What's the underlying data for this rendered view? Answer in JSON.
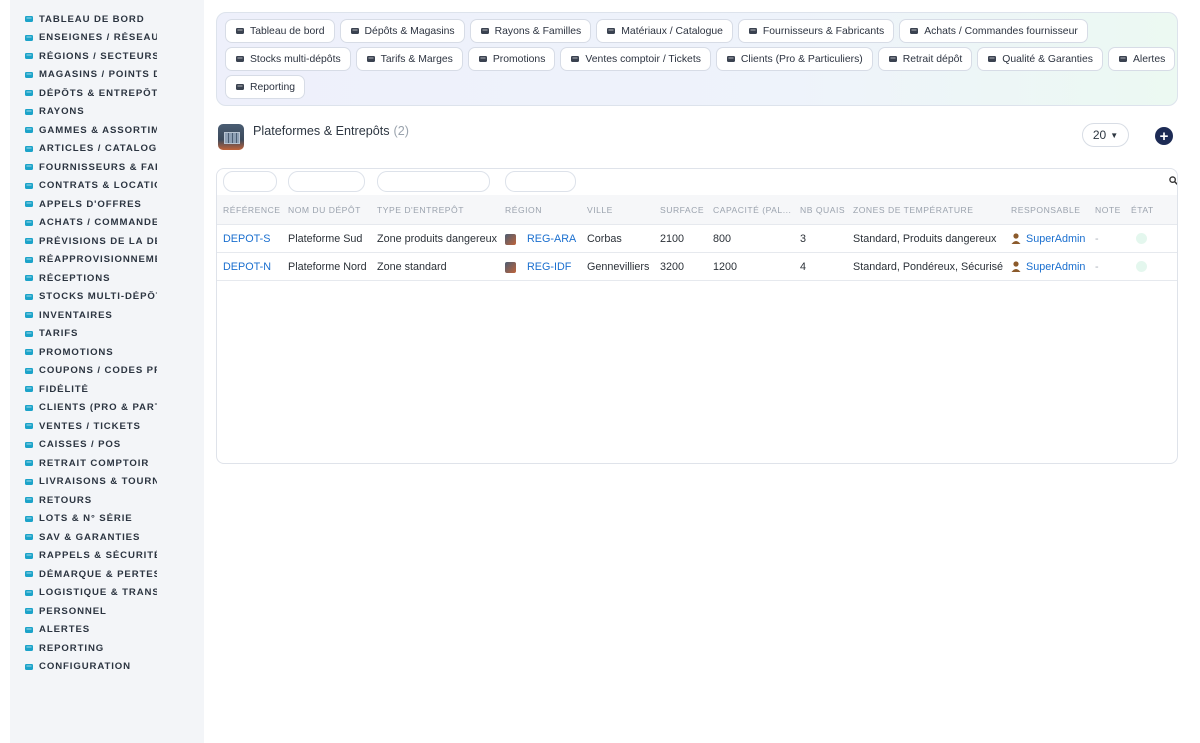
{
  "sidebar": {
    "items": [
      {
        "label": "TABLEAU DE BORD",
        "icon": "dashboard-icon"
      },
      {
        "label": "ENSEIGNES / RÉSEAU",
        "icon": "flag-icon"
      },
      {
        "label": "RÉGIONS / SECTEURS",
        "icon": "map-icon"
      },
      {
        "label": "MAGASINS / POINTS DE VENTE",
        "icon": "store-icon"
      },
      {
        "label": "DÉPÔTS & ENTREPÔTS",
        "icon": "warehouse-icon"
      },
      {
        "label": "RAYONS",
        "icon": "shelf-icon"
      },
      {
        "label": "GAMMES & ASSORTIMENTS",
        "icon": "layers-icon"
      },
      {
        "label": "ARTICLES / CATALOGUE",
        "icon": "catalog-icon"
      },
      {
        "label": "FOURNISSEURS & FABRICANTS",
        "icon": "truck-icon"
      },
      {
        "label": "CONTRATS & LOCATION",
        "icon": "contract-icon"
      },
      {
        "label": "APPELS D'OFFRES",
        "icon": "gavel-icon"
      },
      {
        "label": "ACHATS / COMMANDES FOURNISSEUR",
        "icon": "cart-icon"
      },
      {
        "label": "PRÉVISIONS DE LA DEMANDE",
        "icon": "chart-icon"
      },
      {
        "label": "RÉAPPROVISIONNEMENT",
        "icon": "refresh-icon"
      },
      {
        "label": "RÉCEPTIONS",
        "icon": "dolly-icon"
      },
      {
        "label": "STOCKS MULTI-DÉPÔTS",
        "icon": "sitemap-icon"
      },
      {
        "label": "INVENTAIRES",
        "icon": "clipboard-icon"
      },
      {
        "label": "TARIFS",
        "icon": "tags-icon"
      },
      {
        "label": "PROMOTIONS",
        "icon": "percent-icon"
      },
      {
        "label": "COUPONS / CODES PROMO",
        "icon": "ticket-icon"
      },
      {
        "label": "FIDÉLITÉ",
        "icon": "card-icon"
      },
      {
        "label": "CLIENTS (PRO & PARTICULIERS)",
        "icon": "user-icon"
      },
      {
        "label": "VENTES / TICKETS",
        "icon": "receipt-icon"
      },
      {
        "label": "CAISSES / POS",
        "icon": "register-icon"
      },
      {
        "label": "RETRAIT COMPTOIR",
        "icon": "car-icon"
      },
      {
        "label": "LIVRAISONS & TOURNÉES",
        "icon": "delivery-truck-icon"
      },
      {
        "label": "RETOURS",
        "icon": "undo-icon"
      },
      {
        "label": "LOTS & N° SÉRIE",
        "icon": "barcode-icon"
      },
      {
        "label": "SAV & GARANTIES",
        "icon": "tools-icon"
      },
      {
        "label": "RAPPELS & SÉCURITÉ",
        "icon": "warning-icon"
      },
      {
        "label": "DÉMARQUE & PERTES",
        "icon": "trash-icon"
      },
      {
        "label": "LOGISTIQUE & TRANSPORT",
        "icon": "route-icon"
      },
      {
        "label": "PERSONNEL",
        "icon": "users-icon"
      },
      {
        "label": "ALERTES",
        "icon": "bell-icon"
      },
      {
        "label": "REPORTING",
        "icon": "pie-chart-icon"
      },
      {
        "label": "CONFIGURATION",
        "icon": "gear-icon"
      }
    ]
  },
  "topnav": {
    "rows": [
      [
        {
          "label": "Tableau de bord",
          "icon": "dashboard-icon"
        },
        {
          "label": "Dépôts & Magasins",
          "icon": "warehouse-icon"
        },
        {
          "label": "Rayons & Familles",
          "icon": "basket-icon"
        },
        {
          "label": "Matériaux / Catalogue",
          "icon": "catalog-icon"
        },
        {
          "label": "Fournisseurs & Fabricants",
          "icon": "truck-icon"
        },
        {
          "label": "Achats / Commandes fournisseur",
          "icon": "cart-icon"
        }
      ],
      [
        {
          "label": "Stocks multi-dépôts",
          "icon": "sitemap-icon"
        },
        {
          "label": "Tarifs & Marges",
          "icon": "tags-icon"
        },
        {
          "label": "Promotions",
          "icon": "percent-icon"
        },
        {
          "label": "Ventes comptoir / Tickets",
          "icon": "receipt-icon"
        },
        {
          "label": "Clients (Pro & Particuliers)",
          "icon": "user-icon"
        },
        {
          "label": "Retrait dépôt",
          "icon": "car-icon"
        },
        {
          "label": "Qualité & Garanties",
          "icon": "check-double-icon"
        },
        {
          "label": "Alertes",
          "icon": "bell-icon"
        }
      ],
      [
        {
          "label": "Reporting",
          "icon": "pie-chart-icon"
        }
      ]
    ]
  },
  "page": {
    "title": "Plateformes & Entrepôts",
    "count": "(2)",
    "per_page": "20"
  },
  "table": {
    "headers": [
      "RÉFÉRENCE",
      "NOM DU DÉPÔT",
      "TYPE D'ENTREPÔT",
      "RÉGION",
      "VILLE",
      "SURFACE",
      "CAPACITÉ (PAL...",
      "NB QUAIS",
      "ZONES DE TEMPÉRATURE",
      "RESPONSABLE",
      "NOTE",
      "ÉTAT"
    ],
    "rows": [
      {
        "ref": "DEPOT-S",
        "name": "Plateforme Sud",
        "type": "Zone produits dangereux",
        "region": "REG-ARA",
        "city": "Corbas",
        "surface": "2100",
        "capacity": "800",
        "docks": "3",
        "zones": "Standard, Produits dangereux",
        "manager": "SuperAdmin",
        "note": "-"
      },
      {
        "ref": "DEPOT-N",
        "name": "Plateforme Nord",
        "type": "Zone standard",
        "region": "REG-IDF",
        "city": "Gennevilliers",
        "surface": "3200",
        "capacity": "1200",
        "docks": "4",
        "zones": "Standard, Pondéreux, Sécurisé",
        "manager": "SuperAdmin",
        "note": "-"
      }
    ]
  },
  "colors": {
    "accent_link": "#1a6fcf",
    "sidebar_icon": "#1ba3c9",
    "add_button": "#1d2b55",
    "state_dot": "#e4f7ee"
  }
}
